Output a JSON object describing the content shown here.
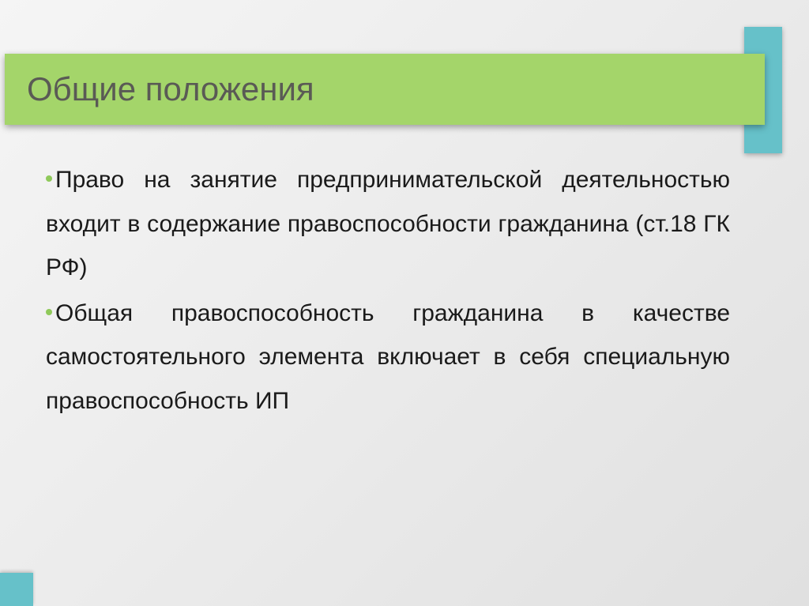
{
  "colors": {
    "title_bar": "#a4d56a",
    "accent": "#66c1c9",
    "bullet": "#8fc95a",
    "title_text": "#5a5a55",
    "body_text": "#1a1a1a"
  },
  "title": "Общие положения",
  "bullets": [
    "Право на занятие предпринимательской деятельностью входит в содержание правоспособности гражданина (ст.18 ГК РФ)",
    "Общая правоспособность гражданина в качестве самостоятельного элемента включает в себя специальную правоспособность ИП"
  ]
}
